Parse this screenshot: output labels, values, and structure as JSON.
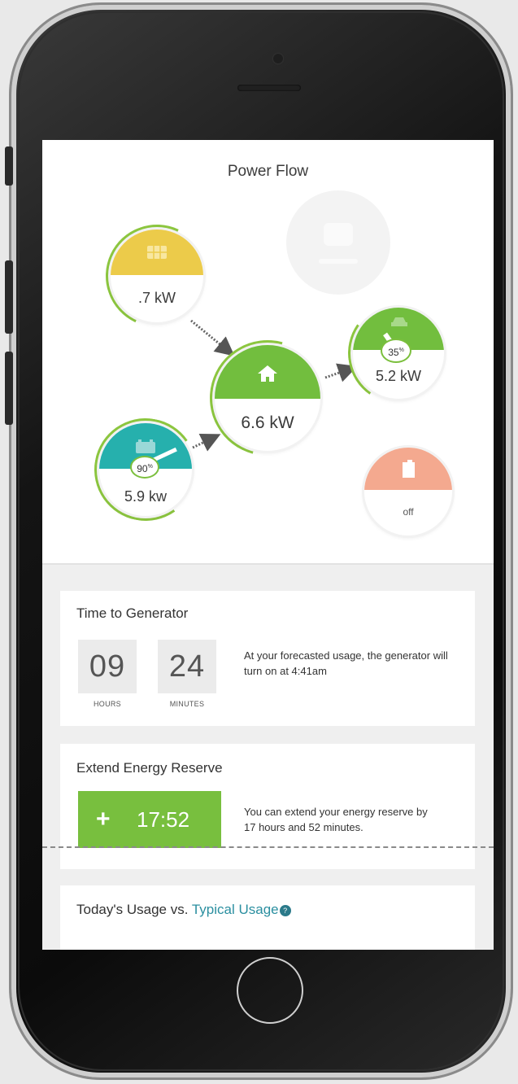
{
  "power_flow": {
    "title": "Power Flow",
    "solar": {
      "value": ".7 kW",
      "icon": "solar-panel-icon",
      "color": "#eccb4a"
    },
    "home": {
      "value": "6.6 kW",
      "icon": "house-icon",
      "color": "#72be3e"
    },
    "battery": {
      "value": "5.9 kw",
      "percent_main": "90",
      "percent_sup": "%",
      "icon": "battery-icon",
      "color": "#26b0ad"
    },
    "ev": {
      "value": "5.2 kW",
      "percent_main": "35",
      "percent_sup": "%",
      "icon": "car-icon",
      "color": "#72be3e"
    },
    "generator": {
      "value": "off",
      "icon": "fuel-can-icon",
      "color": "#f4a98f"
    },
    "grid": {
      "icon": "grid-icon",
      "state": "inactive"
    }
  },
  "time_to_generator": {
    "title": "Time to Generator",
    "hours": "09",
    "separator": ":",
    "minutes": "24",
    "hours_label": "HOURS",
    "minutes_label": "MINUTES",
    "line1": "At your forecasted usage, the generator will",
    "line2": "turn on at 4:41am"
  },
  "extend_reserve": {
    "title": "Extend Energy Reserve",
    "button_plus": "+",
    "button_time": "17:52",
    "line1": "You can extend your energy reserve by",
    "line2": "17 hours and 52 minutes."
  },
  "usage": {
    "title_prefix": "Today's Usage vs. ",
    "title_link": "Typical Usage",
    "help": "?"
  },
  "colors": {
    "accent_green": "#78bf3e",
    "link_teal": "#2b8fa0"
  }
}
